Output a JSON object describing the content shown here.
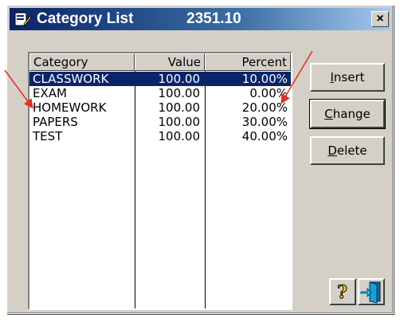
{
  "window": {
    "title": "Category List",
    "title_value": "2351.10",
    "close_label": "×"
  },
  "columns": [
    "Category",
    "Value",
    "Percent"
  ],
  "rows": [
    {
      "category": "CLASSWORK",
      "value": "100.00",
      "percent": "10.00%",
      "selected": true
    },
    {
      "category": "EXAM",
      "value": "100.00",
      "percent": "0.00%",
      "selected": false
    },
    {
      "category": "HOMEWORK",
      "value": "100.00",
      "percent": "20.00%",
      "selected": false
    },
    {
      "category": "PAPERS",
      "value": "100.00",
      "percent": "30.00%",
      "selected": false
    },
    {
      "category": "TEST",
      "value": "100.00",
      "percent": "40.00%",
      "selected": false
    }
  ],
  "buttons": {
    "insert": {
      "first": "I",
      "rest": "nsert"
    },
    "change": {
      "first": "C",
      "rest": "hange"
    },
    "delete": {
      "first": "D",
      "rest": "elete"
    }
  },
  "icons": {
    "app": "app-icon",
    "help": "help-icon",
    "exit": "exit-door-icon"
  },
  "colors": {
    "title_gradient_start": "#0a246a",
    "selection": "#0a246a",
    "annotation_arrow": "#e03020"
  }
}
